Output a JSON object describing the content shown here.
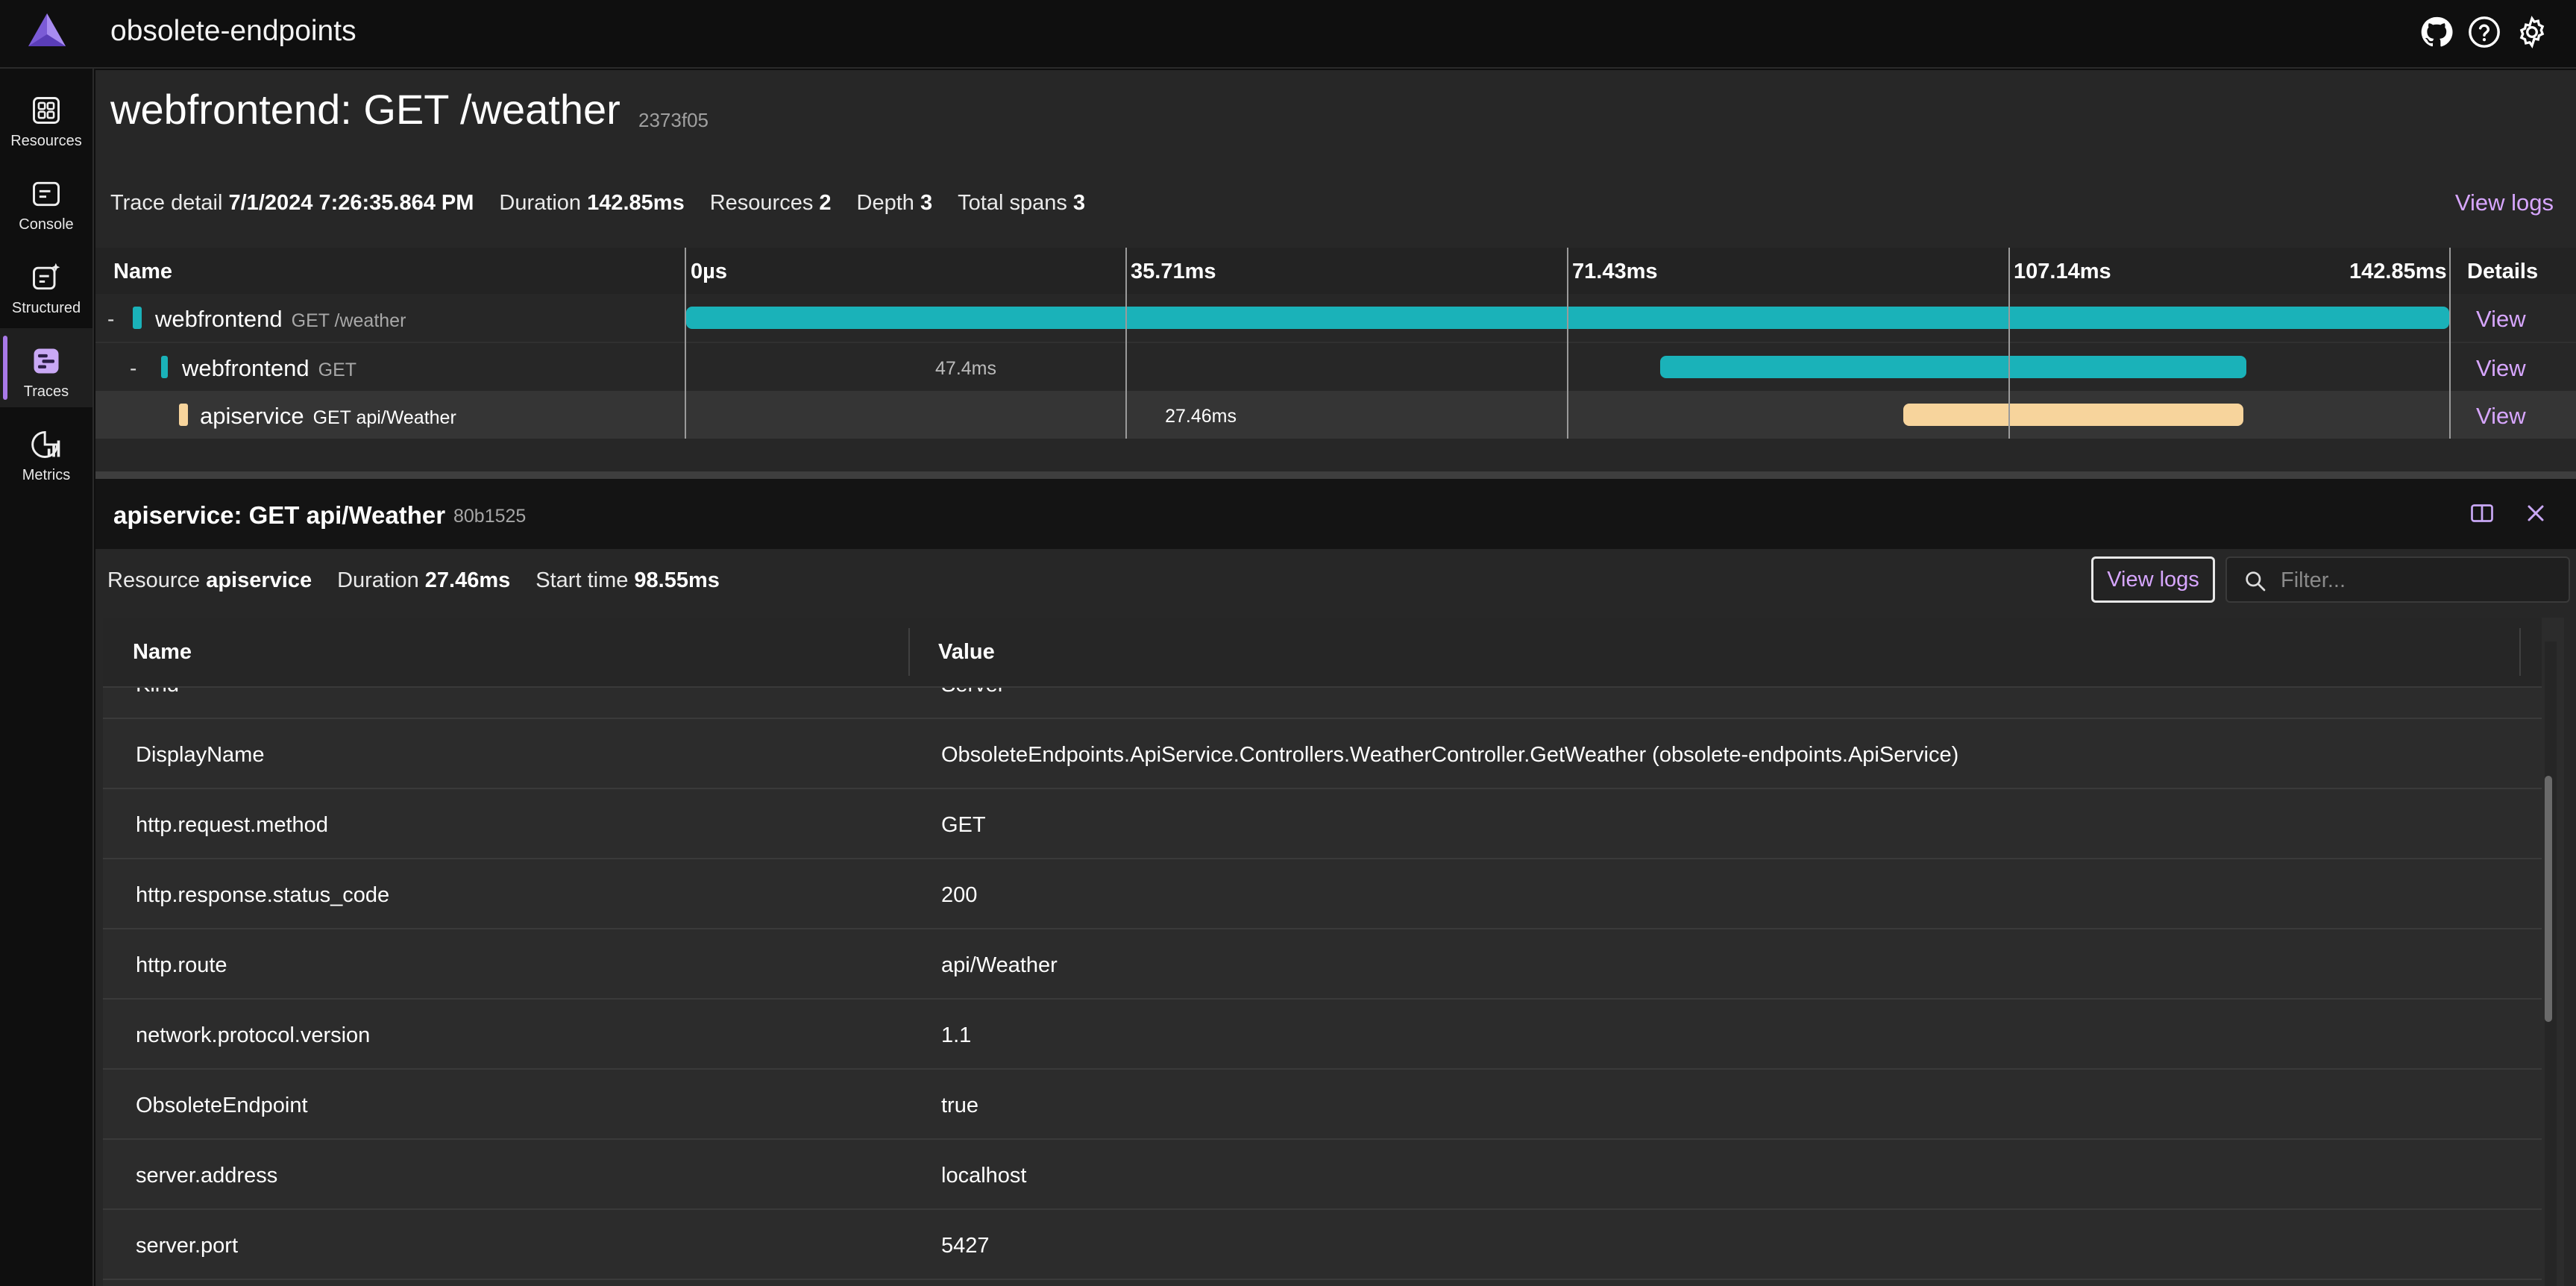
{
  "app": {
    "title": "obsolete-endpoints"
  },
  "nav": [
    {
      "label": "Resources",
      "icon": "grid-icon"
    },
    {
      "label": "Console",
      "icon": "console-icon"
    },
    {
      "label": "Structured",
      "icon": "structured-icon"
    },
    {
      "label": "Traces",
      "icon": "traces-icon",
      "active": true
    },
    {
      "label": "Metrics",
      "icon": "metrics-icon"
    }
  ],
  "trace": {
    "title": "webfrontend: GET /weather",
    "id": "2373f05",
    "summary": {
      "detail_label": "Trace detail",
      "detail_value": "7/1/2024 7:26:35.864 PM",
      "duration_label": "Duration",
      "duration_value": "142.85ms",
      "resources_label": "Resources",
      "resources_value": "2",
      "depth_label": "Depth",
      "depth_value": "3",
      "spans_label": "Total spans",
      "spans_value": "3"
    },
    "view_logs": "View logs"
  },
  "timeline": {
    "name_header": "Name",
    "details_header": "Details",
    "ticks": [
      "0µs",
      "35.71ms",
      "71.43ms",
      "107.14ms",
      "142.85ms"
    ],
    "rows": [
      {
        "expander": "-",
        "service": "webfrontend",
        "operation": "GET /weather",
        "duration_label": "",
        "color": "#1ab2b9",
        "view": "View"
      },
      {
        "expander": "-",
        "service": "webfrontend",
        "operation": "GET",
        "duration_label": "47.4ms",
        "color": "#1ab2b9",
        "view": "View"
      },
      {
        "expander": "",
        "service": "apiservice",
        "operation": "GET api/Weather",
        "duration_label": "27.46ms",
        "color": "#f7d49c",
        "view": "View"
      }
    ]
  },
  "detail": {
    "title": "apiservice: GET api/Weather",
    "id": "80b1525",
    "resource_label": "Resource",
    "resource_value": "apiservice",
    "duration_label": "Duration",
    "duration_value": "27.46ms",
    "start_label": "Start time",
    "start_value": "98.55ms",
    "view_logs": "View logs",
    "filter_placeholder": "Filter...",
    "name_header": "Name",
    "value_header": "Value",
    "rows": [
      {
        "name": "Kind",
        "value": "Server"
      },
      {
        "name": "DisplayName",
        "value": "ObsoleteEndpoints.ApiService.Controllers.WeatherController.GetWeather (obsolete-endpoints.ApiService)"
      },
      {
        "name": "http.request.method",
        "value": "GET"
      },
      {
        "name": "http.response.status_code",
        "value": "200"
      },
      {
        "name": "http.route",
        "value": "api/Weather"
      },
      {
        "name": "network.protocol.version",
        "value": "1.1"
      },
      {
        "name": "ObsoleteEndpoint",
        "value": "true"
      },
      {
        "name": "server.address",
        "value": "localhost"
      },
      {
        "name": "server.port",
        "value": "5427"
      }
    ]
  },
  "colors": {
    "accent": "#a879e8",
    "link": "#d7a6ff",
    "teal": "#1ab2b9",
    "peach": "#f7d49c"
  }
}
